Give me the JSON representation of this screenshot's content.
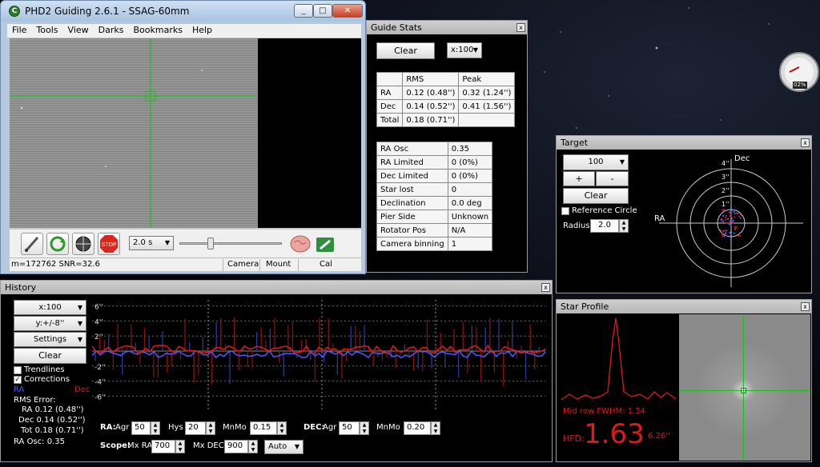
{
  "main_window": {
    "title": "PHD2 Guiding 2.6.1 - SSAG-60mm",
    "icon_letter": "C",
    "menu": [
      "File",
      "Tools",
      "View",
      "Darks",
      "Bookmarks",
      "Help"
    ],
    "exposure": "2.0 s",
    "status": {
      "info": "m=172762 SNR=32.6",
      "camera": "Camera",
      "mount": "Mount",
      "cal": "Cal"
    },
    "toolbar_icons": [
      "loop-icon-pencil",
      "guide-loop-icon",
      "crosshair-icon",
      "stop-icon",
      "brain-icon",
      "wrench-icon"
    ]
  },
  "guide_stats": {
    "title": "Guide Stats",
    "clear": "Clear",
    "scale": "x:100",
    "header": [
      "",
      "RMS",
      "Peak"
    ],
    "rows": [
      [
        "RA",
        "0.12 (0.48'')",
        "0.32 (1.24'')"
      ],
      [
        "Dec",
        "0.14 (0.52'')",
        "0.41 (1.56'')"
      ],
      [
        "Total",
        "0.18 (0.71'')",
        ""
      ]
    ],
    "info": [
      [
        "RA Osc",
        "0.35"
      ],
      [
        "RA Limited",
        "0 (0%)"
      ],
      [
        "Dec Limited",
        "0 (0%)"
      ],
      [
        "Star lost",
        "0"
      ],
      [
        "Declination",
        "0.0 deg"
      ],
      [
        "Pier Side",
        "Unknown"
      ],
      [
        "Rotator Pos",
        "N/A"
      ],
      [
        "Camera binning",
        "1"
      ]
    ]
  },
  "target": {
    "title": "Target",
    "zoom": "100",
    "plus": "+",
    "minus": "-",
    "clear": "Clear",
    "reference_circle": "Reference Circle",
    "radius_label": "Radius:",
    "radius": "2.0",
    "dec_label": "Dec",
    "ra_label": "RA",
    "ticks": [
      "4''",
      "3''",
      "2''",
      "1''"
    ]
  },
  "history": {
    "title": "History",
    "x_scale": "x:100",
    "y_scale": "y:+/-8''",
    "settings": "Settings",
    "clear": "Clear",
    "trendlines": "Trendlines",
    "corrections": "Corrections",
    "ra": "RA",
    "dec": "Dec",
    "rms_error": "RMS Error:",
    "rms_ra": "RA 0.12 (0.48'')",
    "rms_dec": "Dec 0.14 (0.52'')",
    "rms_tot": "Tot 0.18 (0.71'')",
    "ra_osc": "RA Osc: 0.35",
    "y_ticks": [
      "6''",
      "4''",
      "2''",
      "-2''",
      "-4''",
      "-6''"
    ],
    "controls": {
      "ra_label": "RA:",
      "agr_label": "Agr",
      "ra_agr": "50",
      "hys_label": "Hys",
      "ra_hys": "20",
      "mnmo_label": "MnMo",
      "ra_mnmo": "0.15",
      "dec_label": "DEC:",
      "dec_agr": "50",
      "dec_mnmo": "0.20",
      "scope_label": "Scope:",
      "mx_ra_label": "Mx RA",
      "mx_ra": "700",
      "mx_dec_label": "Mx DEC",
      "mx_dec": "900",
      "mode": "Auto"
    }
  },
  "star_profile": {
    "title": "Star Profile",
    "fwhm": "Mid row FWHM: 1.34",
    "hfd_label": "HFD:",
    "hfd_value": "1.63",
    "hfd_arcsec": "6.26''"
  },
  "gauge": {
    "value": "02%"
  },
  "colors": {
    "ra": "#4a5cff",
    "dec": "#e01a1a",
    "crosshair": "#16c116",
    "panel_bg": "#000000"
  }
}
